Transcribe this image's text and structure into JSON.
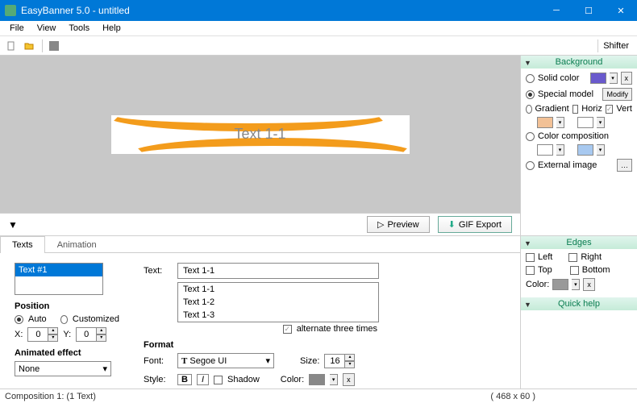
{
  "window": {
    "title": "EasyBanner 5.0 - untitled"
  },
  "menu": {
    "file": "File",
    "view": "View",
    "tools": "Tools",
    "help": "Help"
  },
  "toolbar": {
    "shifter": "Shifter"
  },
  "canvas": {
    "banner_text": "Text 1-1",
    "preview": "Preview",
    "gif_export": "GIF Export"
  },
  "panel_bg": {
    "title": "Background",
    "solid": "Solid color",
    "special": "Special model",
    "modify": "Modify",
    "gradient": "Gradient",
    "horiz": "Horiz",
    "vert": "Vert",
    "colorcomp": "Color composition",
    "external": "External image",
    "colors": {
      "solid": "#6a5acd",
      "grad1": "#f2c196",
      "grad2": "#ffffff",
      "cc1": "#ffffff",
      "cc2": "#a8c9f0"
    }
  },
  "panel_edges": {
    "title": "Edges",
    "left": "Left",
    "right": "Right",
    "top": "Top",
    "bottom": "Bottom",
    "color_label": "Color:",
    "color": "#999999"
  },
  "panel_help": {
    "title": "Quick help"
  },
  "tabs": {
    "texts": "Texts",
    "animation": "Animation"
  },
  "texts_panel": {
    "list": [
      "Text #1"
    ],
    "position_label": "Position",
    "auto": "Auto",
    "custom": "Customized",
    "x_label": "X:",
    "x_val": "0",
    "y_label": "Y:",
    "y_val": "0",
    "anim_label": "Animated effect",
    "anim_val": "None",
    "text_label": "Text:",
    "text_val": "Text 1-1",
    "lines": [
      "Text 1-1",
      "Text 1-2",
      "Text 1-3"
    ],
    "alternate": "alternate three times",
    "format_label": "Format",
    "font_label": "Font:",
    "font_val": "Segoe UI",
    "size_label": "Size:",
    "size_val": "16",
    "style_label": "Style:",
    "shadow": "Shadow",
    "color_label": "Color:",
    "color": "#888888"
  },
  "status": {
    "comp": "Composition 1:  (1 Text)",
    "dims": "( 468 x 60 )"
  }
}
